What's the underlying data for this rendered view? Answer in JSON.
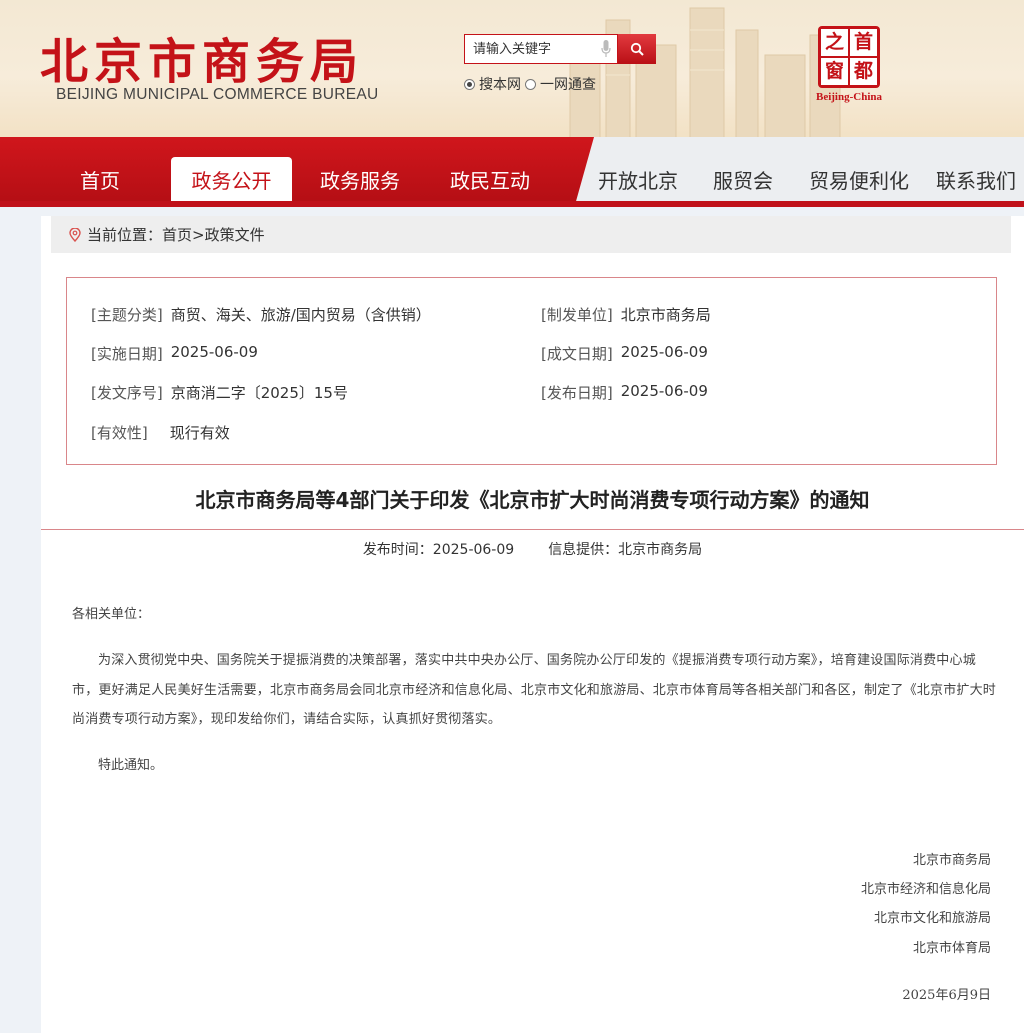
{
  "header": {
    "logo_cn": "北京市商务局",
    "logo_en": "BEIJING MUNICIPAL COMMERCE BUREAU",
    "search": {
      "placeholder": "请输入关键字"
    },
    "search_scope": [
      {
        "label": "搜本网",
        "selected": true
      },
      {
        "label": "一网通查",
        "selected": false
      }
    ],
    "capital_logo": {
      "chars": [
        "之",
        "首",
        "窗",
        "都"
      ],
      "en": "Beijing-China"
    }
  },
  "nav": {
    "items": [
      {
        "label": "首页",
        "active": false
      },
      {
        "label": "政务公开",
        "active": true
      },
      {
        "label": "政务服务",
        "active": false
      },
      {
        "label": "政民互动",
        "active": false
      },
      {
        "label": "开放北京",
        "active": false
      },
      {
        "label": "服贸会",
        "active": false
      },
      {
        "label": "贸易便利化",
        "active": false
      },
      {
        "label": "联系我们",
        "active": false
      }
    ]
  },
  "breadcrumb": {
    "text": "当前位置：首页>政策文件"
  },
  "meta": {
    "topic_label": "[主题分类]",
    "topic_value": "商贸、海关、旅游/国内贸易（含供销）",
    "issuer_label": "[制发单位]",
    "issuer_value": "北京市商务局",
    "effective_label": "[实施日期]",
    "effective_value": "2025-06-09",
    "written_label": "[成文日期]",
    "written_value": "2025-06-09",
    "docno_label": "[发文序号]",
    "docno_value": "京商消二字〔2025〕15号",
    "publish_label": "[发布日期]",
    "publish_value": "2025-06-09",
    "validity_label": "[有效性]",
    "validity_value": "现行有效"
  },
  "article": {
    "title": "北京市商务局等4部门关于印发《北京市扩大时尚消费专项行动方案》的通知",
    "publish_time": "发布时间：2025-06-09",
    "source": "信息提供：北京市商务局",
    "salutation": "各相关单位：",
    "paragraph": "为深入贯彻党中央、国务院关于提振消费的决策部署，落实中共中央办公厅、国务院办公厅印发的《提振消费专项行动方案》，培育建设国际消费中心城市，更好满足人民美好生活需要，北京市商务局会同北京市经济和信息化局、北京市文化和旅游局、北京市体育局等各相关部门和各区，制定了《北京市扩大时尚消费专项行动方案》，现印发给你们，请结合实际，认真抓好贯彻落实。",
    "closing": "特此通知。",
    "signatures": [
      "北京市商务局",
      "北京市经济和信息化局",
      "北京市文化和旅游局",
      "北京市体育局"
    ],
    "date": "2025年6月9日"
  }
}
